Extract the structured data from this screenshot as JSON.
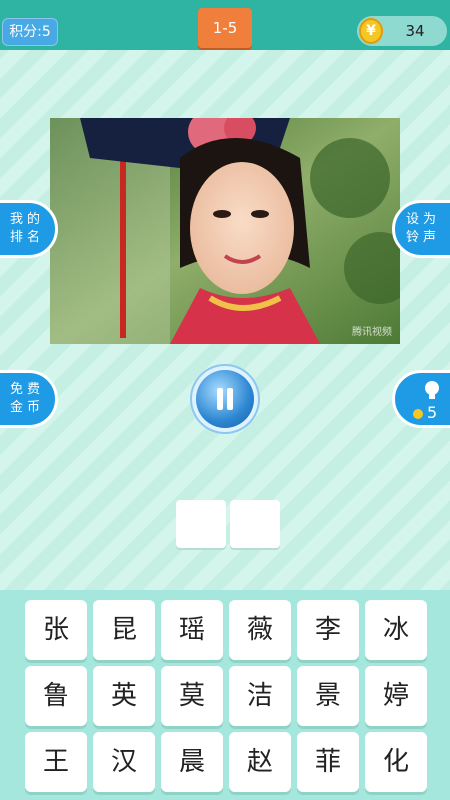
{
  "header": {
    "score": "积分:5",
    "level": "1-5",
    "coins": "34"
  },
  "puzzle": {
    "watermark": "腾讯视频"
  },
  "side_buttons": {
    "ranking": "我的排名",
    "ringtone": "设为铃声",
    "free_coins": "免费金币",
    "hint_count": "5"
  },
  "keyboard": {
    "rows": [
      [
        "张",
        "昆",
        "瑶",
        "薇",
        "李",
        "冰"
      ],
      [
        "鲁",
        "英",
        "莫",
        "洁",
        "景",
        "婷"
      ],
      [
        "王",
        "汉",
        "晨",
        "赵",
        "菲",
        "化"
      ]
    ]
  },
  "colors": {
    "header": "#2fb3a3",
    "accent_blue": "#1e9be4",
    "level_orange": "#f07f3c",
    "coin_gold": "#f5c723"
  }
}
